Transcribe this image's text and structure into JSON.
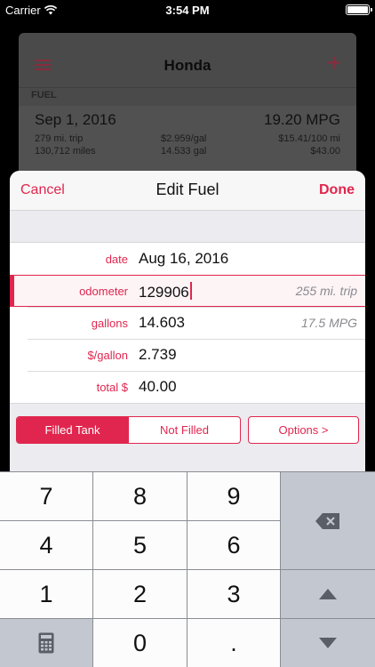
{
  "status_bar": {
    "carrier": "Carrier",
    "time": "3:54 PM"
  },
  "background": {
    "nav_title": "Honda",
    "section_header": "FUEL",
    "entry": {
      "date": "Sep 1, 2016",
      "mpg": "19.20 MPG",
      "trip": "279 mi. trip",
      "odometer": "130,712 miles",
      "price": "$2.959/gal",
      "gallons": "14.533 gal",
      "cost_per_100": "$15.41/100 mi",
      "total": "$43.00"
    }
  },
  "sheet": {
    "cancel_label": "Cancel",
    "title": "Edit Fuel",
    "done_label": "Done",
    "fields": [
      {
        "label": "date",
        "value": "Aug 16, 2016",
        "hint": ""
      },
      {
        "label": "odometer",
        "value": "129906",
        "hint": "255 mi. trip"
      },
      {
        "label": "gallons",
        "value": "14.603",
        "hint": "17.5 MPG"
      },
      {
        "label": "$/gallon",
        "value": "2.739",
        "hint": ""
      },
      {
        "label": "total $",
        "value": "40.00",
        "hint": ""
      }
    ],
    "segment": {
      "filled": "Filled Tank",
      "not_filled": "Not Filled",
      "selected": "Filled Tank"
    },
    "options_label": "Options >"
  },
  "keypad": {
    "keys": [
      "7",
      "8",
      "9",
      "4",
      "5",
      "6",
      "1",
      "2",
      "3",
      "0",
      "."
    ],
    "side_keys": [
      "backspace-icon",
      "up-arrow-icon",
      "down-arrow-icon"
    ],
    "bottom_left": "calculator-icon"
  },
  "colors": {
    "accent": "#e0264e",
    "keypad_bg": "#8a8d93"
  }
}
